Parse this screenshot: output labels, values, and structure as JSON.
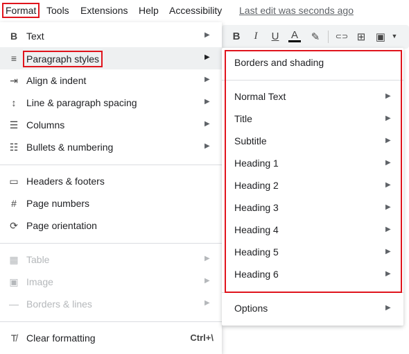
{
  "menubar": {
    "items": [
      "Format",
      "Tools",
      "Extensions",
      "Help",
      "Accessibility"
    ],
    "last_edit": "Last edit was seconds ago"
  },
  "toolbar": {
    "icons": [
      "bold-icon",
      "italic-icon",
      "underline-icon",
      "text-color-icon",
      "highlight-icon",
      "link-icon",
      "comment-icon",
      "image-icon"
    ],
    "glyphs": [
      "B",
      "I",
      "U",
      "A",
      "✎",
      "⊂⊃",
      "⊞",
      "▣"
    ]
  },
  "format_menu": {
    "items": [
      {
        "label": "Text",
        "icon": "bold-icon",
        "glyph": "B",
        "has_submenu": true
      },
      {
        "label": "Paragraph styles",
        "icon": "paragraph-styles-icon",
        "glyph": "≡",
        "has_submenu": true
      },
      {
        "label": "Align & indent",
        "icon": "indent-icon",
        "glyph": "⇥",
        "has_submenu": true
      },
      {
        "label": "Line & paragraph spacing",
        "icon": "line-spacing-icon",
        "glyph": "↕",
        "has_submenu": true
      },
      {
        "label": "Columns",
        "icon": "columns-icon",
        "glyph": "☰",
        "has_submenu": true
      },
      {
        "label": "Bullets & numbering",
        "icon": "bullets-icon",
        "glyph": "☷",
        "has_submenu": true
      },
      {
        "label": "Headers & footers",
        "icon": "header-footer-icon",
        "glyph": "▭",
        "has_submenu": false
      },
      {
        "label": "Page numbers",
        "icon": "hash-icon",
        "glyph": "#",
        "has_submenu": false
      },
      {
        "label": "Page orientation",
        "icon": "page-orientation-icon",
        "glyph": "⟳",
        "has_submenu": false
      },
      {
        "label": "Table",
        "icon": "table-icon",
        "glyph": "▦",
        "has_submenu": true,
        "disabled": true
      },
      {
        "label": "Image",
        "icon": "image-icon",
        "glyph": "▣",
        "has_submenu": true,
        "disabled": true
      },
      {
        "label": "Borders & lines",
        "icon": "line-icon",
        "glyph": "—",
        "has_submenu": true,
        "disabled": true
      },
      {
        "label": "Clear formatting",
        "icon": "clear-formatting-icon",
        "glyph": "T̸",
        "shortcut": "Ctrl+\\"
      }
    ]
  },
  "paragraph_styles_menu": {
    "items": [
      {
        "label": "Borders and shading",
        "has_submenu": false
      },
      {
        "label": "Normal Text",
        "has_submenu": true
      },
      {
        "label": "Title",
        "has_submenu": true
      },
      {
        "label": "Subtitle",
        "has_submenu": true
      },
      {
        "label": "Heading 1",
        "has_submenu": true
      },
      {
        "label": "Heading 2",
        "has_submenu": true
      },
      {
        "label": "Heading 3",
        "has_submenu": true
      },
      {
        "label": "Heading 4",
        "has_submenu": true
      },
      {
        "label": "Heading 5",
        "has_submenu": true
      },
      {
        "label": "Heading 6",
        "has_submenu": true
      },
      {
        "label": "Options",
        "has_submenu": true
      }
    ]
  },
  "colors": {
    "highlight_box": "#e0141c",
    "active_row": "#eef0f1"
  }
}
